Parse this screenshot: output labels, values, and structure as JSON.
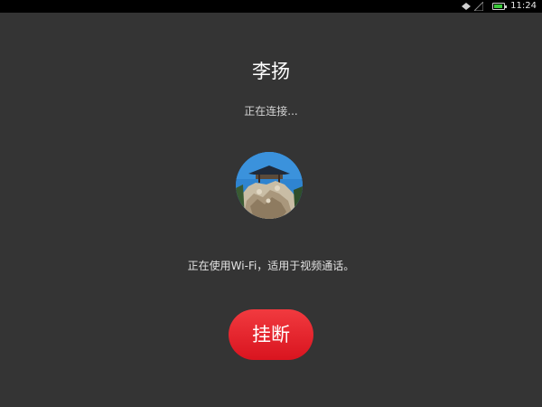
{
  "status_bar": {
    "time": "11:24",
    "battery_level": 0.85,
    "icons": [
      "wifi-icon",
      "signal-icon",
      "battery-icon"
    ],
    "colors": {
      "battery": "#3ac83a",
      "background": "#000000"
    }
  },
  "call": {
    "caller_name": "李扬",
    "status_text": "正在连接...",
    "network_note": "正在使用Wi-Fi，适用于视频通话。",
    "hangup_label": "挂断"
  },
  "colors": {
    "background": "#343434",
    "hangup_button": "#e8212b",
    "text_primary": "#ffffff"
  }
}
